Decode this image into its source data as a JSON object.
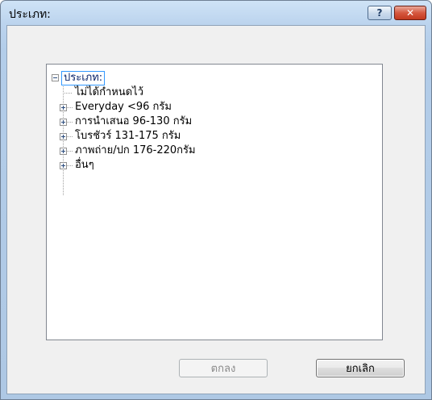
{
  "window": {
    "title": "ประเภท:",
    "help_label": "?",
    "close_label": "✕"
  },
  "tree": {
    "root": "ประเภท:",
    "items": [
      {
        "label": "ไม่ได้กำหนดไว้",
        "expandable": false
      },
      {
        "label": "Everyday <96 กรัม",
        "expandable": true
      },
      {
        "label": "การนำเสนอ 96-130 กรัม",
        "expandable": true
      },
      {
        "label": "โบรชัวร์ 131-175 กรัม",
        "expandable": true
      },
      {
        "label": "ภาพถ่าย/ปก 176-220กรัม",
        "expandable": true
      },
      {
        "label": "อื่นๆ",
        "expandable": true
      }
    ]
  },
  "buttons": {
    "ok": "ตกลง",
    "cancel": "ยกเลิก"
  },
  "icons": {
    "collapse": "minus-box-icon",
    "expand": "plus-box-icon"
  }
}
